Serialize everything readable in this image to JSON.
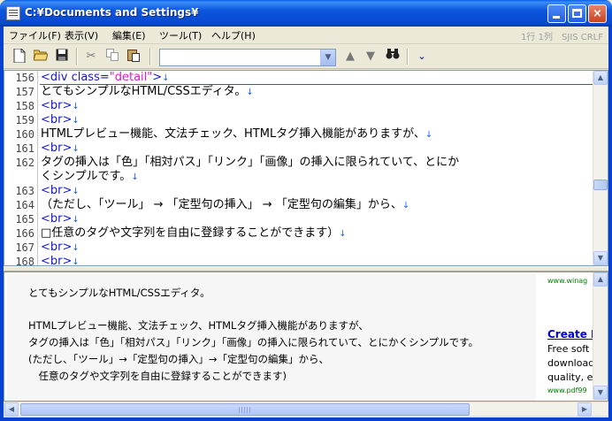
{
  "window": {
    "title": "C:¥Documents and Settings¥",
    "controls": {
      "minimize": "minimize",
      "maximize": "maximize",
      "close": "×"
    }
  },
  "menu": {
    "items": [
      "ファイル(F)",
      "表示(V)",
      "編集(E)",
      "ツール(T)",
      "ヘルプ(H)"
    ],
    "status": "1行 1列　SJIS CRLF"
  },
  "toolbar": {
    "icons": [
      "new-file-icon",
      "open-folder-icon",
      "save-icon",
      "cut-icon",
      "copy-icon",
      "paste-icon",
      "arrow-up-icon",
      "arrow-down-icon",
      "binoculars-icon",
      "chevron-down-icon"
    ],
    "combo_value": ""
  },
  "editor": {
    "eol_mark": "↓",
    "lines": [
      {
        "num": "156",
        "tag_open": "<div",
        "attr": " class=",
        "str": "\"detail\"",
        "tag_close": ">",
        "text": ""
      },
      {
        "num": "157",
        "text": "とてもシンプルなHTML/CSSエディタ。"
      },
      {
        "num": "158",
        "tag": "<br>"
      },
      {
        "num": "159",
        "tag": "<br>"
      },
      {
        "num": "160",
        "text": "HTMLプレビュー機能、文法チェック、HTMLタグ挿入機能がありますが、"
      },
      {
        "num": "161",
        "tag": "<br>"
      },
      {
        "num": "162",
        "text": "タグの挿入は「色」「相対パス」「リンク」「画像」の挿入に限られていて、とにか"
      },
      {
        "num": "",
        "text": "くシンプルです。"
      },
      {
        "num": "163",
        "tag": "<br>"
      },
      {
        "num": "164",
        "text": "（ただし、「ツール」 → 「定型句の挿入」 → 「定型句の編集」から、"
      },
      {
        "num": "165",
        "tag": "<br>"
      },
      {
        "num": "166",
        "text": "□任意のタグや文字列を自由に登録することができます）"
      },
      {
        "num": "167",
        "tag": "<br>"
      },
      {
        "num": "168",
        "tag": "<br>"
      }
    ]
  },
  "preview": {
    "lines": [
      "とてもシンプルなHTML/CSSエディタ。",
      "HTMLプレビュー機能、文法チェック、HTMLタグ挿入機能がありますが、",
      "タグの挿入は「色」「相対パス」「リンク」「画像」の挿入に限られていて、とにかくシンプルです。",
      "(ただし、「ツール」→「定型句の挿入」→「定型句の編集」から、",
      "　任意のタグや文字列を自由に登録することができます)"
    ],
    "ad": {
      "url_top": "www.winag",
      "title": "Create F",
      "desc": [
        "Free soft",
        "download",
        "quality, e"
      ],
      "url_bottom": "www.pdf99"
    }
  }
}
